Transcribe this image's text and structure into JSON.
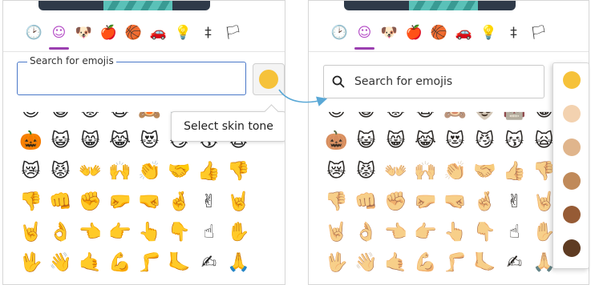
{
  "categories": [
    {
      "name": "recent-icon",
      "glyph": "🕑"
    },
    {
      "name": "smileys-icon",
      "glyph": "☺"
    },
    {
      "name": "animals-icon",
      "glyph": "🐶"
    },
    {
      "name": "food-icon",
      "glyph": "🍎"
    },
    {
      "name": "activity-icon",
      "glyph": "🏀"
    },
    {
      "name": "travel-icon",
      "glyph": "🚗"
    },
    {
      "name": "objects-icon",
      "glyph": "💡"
    },
    {
      "name": "symbols-icon",
      "glyph": "‡"
    },
    {
      "name": "flags-icon",
      "glyph": "🏳"
    }
  ],
  "left": {
    "search_legend": "Search for emojis",
    "tooltip": "Select skin tone",
    "selected_tone_color": "#f6c23a"
  },
  "right": {
    "search_placeholder": "Search for emojis"
  },
  "grid_rows": [
    [
      "😈",
      "😺",
      "😾",
      "🙀",
      "🙈",
      "👽",
      "🤖",
      "😸"
    ],
    [
      "🎃",
      "😺",
      "😸",
      "😹",
      "😻",
      "😼",
      "😽",
      "🙀"
    ],
    [
      "😿",
      "😾",
      "👐",
      "🙌",
      "👏",
      "🤝",
      "👍",
      "👎"
    ],
    [
      "👎",
      "👊",
      "✊",
      "🤛",
      "🤜",
      "🤞",
      "✌",
      "🤘"
    ],
    [
      "🤘",
      "👌",
      "👈",
      "👉",
      "👆",
      "👇",
      "☝",
      "✋"
    ],
    [
      "🖖",
      "👋",
      "🤙",
      "💪",
      "🦵",
      "🦶",
      "✍",
      "🙏"
    ]
  ],
  "skin_tones": [
    "#f6c23a",
    "#f3d2b0",
    "#e0b58c",
    "#c08a5a",
    "#965b35",
    "#5e3b22"
  ]
}
